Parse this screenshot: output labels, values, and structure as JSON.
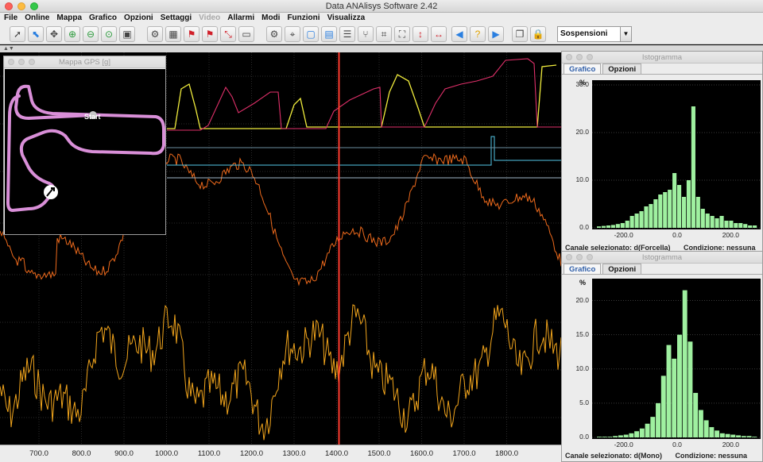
{
  "app": {
    "title": "Data ANAlisys Software 2.42"
  },
  "menu": [
    "File",
    "Online",
    "Mappa",
    "Grafico",
    "Opzioni",
    "Settaggi",
    "Video",
    "Allarmi",
    "Modi",
    "Funzioni",
    "Visualizza"
  ],
  "menu_disabled": [
    "Video"
  ],
  "toolbar": {
    "combo_value": "Sospensioni",
    "buttons": [
      "pointer-icon",
      "select-icon",
      "pan-icon",
      "zoom-in-icon",
      "zoom-out-icon",
      "zoom-fit-icon",
      "window-icon",
      "gear-icon",
      "checkered-flag-icon",
      "red-flag-icon",
      "flag-alt-icon",
      "compress-icon",
      "comment-icon",
      "gear2-icon",
      "cursor-icon",
      "layout1-icon",
      "layout2-icon",
      "table-icon",
      "branch-icon",
      "fit-icon",
      "expand-icon",
      "vexpand-icon",
      "hexpand-icon",
      "prev-icon",
      "help-icon",
      "next-icon",
      "copy-icon",
      "lock-icon"
    ]
  },
  "main_chart": {
    "x_ticks": [
      "700.0",
      "800.0",
      "900.0",
      "1000.0",
      "1100.0",
      "1200.0",
      "1300.0",
      "1400.0",
      "1500.0",
      "1600.0",
      "1700.0",
      "1800.0"
    ],
    "cursor_x": 1400,
    "colors": {
      "cursor": "#ff3b2f",
      "yellow": "#f0ec3c",
      "pink": "#e0306a",
      "cyan": "#54c8e8",
      "orange": "#ee6a1c",
      "amber": "#f2a51c"
    }
  },
  "gps": {
    "title": "Mappa GPS [g]",
    "start_label": "Start"
  },
  "hist1": {
    "title": "Istogramma",
    "tabs": [
      "Grafico",
      "Opzioni"
    ],
    "y_unit": "%",
    "y_ticks": [
      "30.0",
      "20.0",
      "10.0",
      "0.0"
    ],
    "x_ticks": [
      "-200.0",
      "0.0",
      "200.0"
    ],
    "status_channel": "Canale selezionato: d(Forcella)",
    "status_condition": "Condizione: nessuna",
    "bars": [
      0.3,
      0.4,
      0.5,
      0.6,
      0.8,
      1.0,
      1.5,
      2.5,
      3.0,
      3.5,
      4.5,
      5.0,
      6.0,
      7.0,
      7.5,
      8.0,
      11.5,
      9.0,
      6.5,
      10.0,
      25.5,
      6.5,
      4.0,
      3.0,
      2.5,
      2.0,
      2.5,
      1.5,
      1.5,
      1.0,
      1.0,
      0.8,
      0.5,
      0.5
    ],
    "bar_color": "#9ff0a0"
  },
  "hist2": {
    "title": "Istogramma",
    "tabs": [
      "Grafico",
      "Opzioni"
    ],
    "y_unit": "%",
    "y_ticks": [
      "20.0",
      "15.0",
      "10.0",
      "5.0",
      "0.0"
    ],
    "x_ticks": [
      "-200.0",
      "0.0",
      "200.0"
    ],
    "status_channel": "Canale selezionato: d(Mono)",
    "status_condition": "Condizione: nessuna",
    "bars": [
      0.1,
      0.1,
      0.1,
      0.2,
      0.3,
      0.4,
      0.6,
      0.9,
      1.3,
      2.0,
      3.0,
      5.0,
      9.0,
      13.5,
      11.5,
      15.0,
      21.5,
      14.0,
      6.5,
      4.0,
      2.5,
      1.5,
      1.0,
      0.6,
      0.5,
      0.4,
      0.3,
      0.2,
      0.2,
      0.1
    ],
    "bar_color": "#9ff0a0"
  }
}
